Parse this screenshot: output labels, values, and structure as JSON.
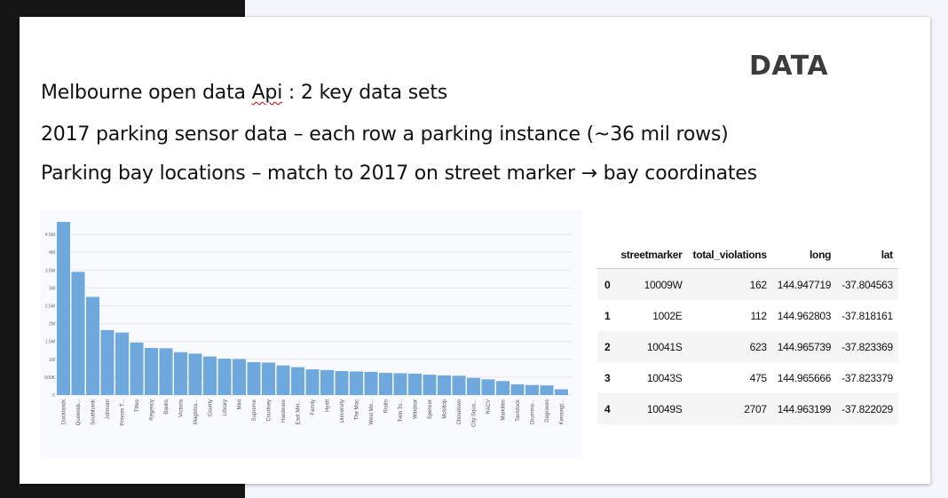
{
  "slide": {
    "title": "DATA",
    "bullets": [
      {
        "pre": "Melbourne open data ",
        "squiggle": "Api",
        "post": " : 2 key data sets"
      },
      {
        "text": "2017 parking sensor data – each row a parking instance (~36 mil rows)"
      },
      {
        "text": "Parking bay locations – match to 2017 on street marker → bay coordinates"
      }
    ]
  },
  "table": {
    "columns": [
      "",
      "streetmarker",
      "total_violations",
      "long",
      "lat"
    ],
    "rows": [
      {
        "idx": "0",
        "streetmarker": "10009W",
        "total_violations": "162",
        "long": "144.947719",
        "lat": "-37.804563"
      },
      {
        "idx": "1",
        "streetmarker": "1002E",
        "total_violations": "112",
        "long": "144.962803",
        "lat": "-37.818161"
      },
      {
        "idx": "2",
        "streetmarker": "10041S",
        "total_violations": "623",
        "long": "144.965739",
        "lat": "-37.823369"
      },
      {
        "idx": "3",
        "streetmarker": "10043S",
        "total_violations": "475",
        "long": "144.965666",
        "lat": "-37.823379"
      },
      {
        "idx": "4",
        "streetmarker": "10049S",
        "total_violations": "2707",
        "long": "144.963199",
        "lat": "-37.822029"
      }
    ]
  },
  "chart_data": {
    "type": "bar",
    "title": "",
    "xlabel": "",
    "ylabel": "",
    "ylim": [
      0,
      4800000
    ],
    "grid": true,
    "color": "#6ea8dc",
    "ytick_values": [
      0,
      500000,
      1000000,
      1500000,
      2000000,
      2500000,
      3000000,
      3500000,
      4000000,
      4500000
    ],
    "ytick_labels": [
      "0",
      "500K",
      "1M",
      "1.5M",
      "2M",
      "2.5M",
      "3M",
      "3.5M",
      "4M",
      "4.5M"
    ],
    "categories": [
      "Docklands",
      "Queensb...",
      "Southbank",
      "Jolimont",
      "Princes T...",
      "Titles",
      "Regency",
      "Banks",
      "Victoria",
      "Magistra...",
      "County",
      "Library",
      "Mint",
      "Supreme",
      "Courtney",
      "Hardware",
      "East Mel...",
      "Family",
      "Hyatt",
      "University",
      "The Mac",
      "West Me...",
      "Rialto",
      "Twin To...",
      "Windsor",
      "Spencer",
      "Mckillop",
      "Chinatown",
      "City Squa...",
      "RACV",
      "Markilles",
      "Tavistock",
      "Drummo...",
      "Degraves",
      "Kensingt..."
    ],
    "values": [
      4850000,
      3450000,
      2750000,
      1820000,
      1750000,
      1470000,
      1320000,
      1310000,
      1200000,
      1160000,
      1080000,
      1020000,
      1010000,
      920000,
      910000,
      830000,
      780000,
      720000,
      700000,
      670000,
      660000,
      650000,
      620000,
      610000,
      600000,
      570000,
      550000,
      540000,
      480000,
      440000,
      390000,
      300000,
      280000,
      270000,
      160000
    ]
  }
}
